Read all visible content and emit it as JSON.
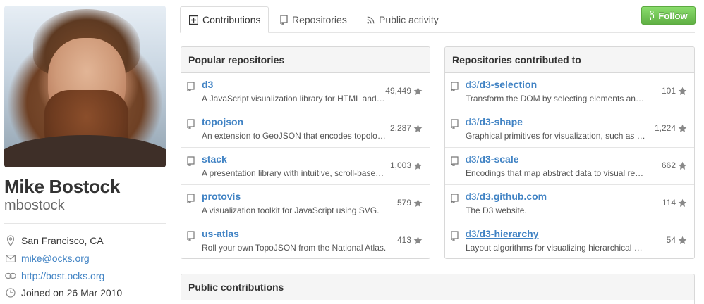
{
  "profile": {
    "fullname": "Mike Bostock",
    "username": "mbostock",
    "details": {
      "location": "San Francisco, CA",
      "email": "mike@ocks.org",
      "website": "http://bost.ocks.org",
      "joined": "Joined on 26 Mar 2010"
    }
  },
  "tabs": {
    "contributions": "Contributions",
    "repositories": "Repositories",
    "public_activity": "Public activity"
  },
  "follow_label": "Follow",
  "popular": {
    "title": "Popular repositories",
    "items": [
      {
        "name": "d3",
        "desc": "A JavaScript visualization library for HTML and SVG.",
        "stars": "49,449"
      },
      {
        "name": "topojson",
        "desc": "An extension to GeoJSON that encodes topology.",
        "stars": "2,287"
      },
      {
        "name": "stack",
        "desc": "A presentation library with intuitive, scroll-based navigation.",
        "stars": "1,003"
      },
      {
        "name": "protovis",
        "desc": "A visualization toolkit for JavaScript using SVG.",
        "stars": "579"
      },
      {
        "name": "us-atlas",
        "desc": "Roll your own TopoJSON from the National Atlas.",
        "stars": "413"
      }
    ]
  },
  "contributed": {
    "title": "Repositories contributed to",
    "items": [
      {
        "owner": "d3/",
        "name": "d3-selection",
        "desc": "Transform the DOM by selecting elements and joining to data.",
        "stars": "101"
      },
      {
        "owner": "d3/",
        "name": "d3-shape",
        "desc": "Graphical primitives for visualization, such as lines and areas.",
        "stars": "1,224"
      },
      {
        "owner": "d3/",
        "name": "d3-scale",
        "desc": "Encodings that map abstract data to visual representation.",
        "stars": "662"
      },
      {
        "owner": "d3/",
        "name": "d3.github.com",
        "desc": "The D3 website.",
        "stars": "114"
      },
      {
        "owner": "d3/",
        "name": "d3-hierarchy",
        "desc": "Layout algorithms for visualizing hierarchical data.",
        "stars": "54"
      }
    ]
  },
  "public_contributions": {
    "title": "Public contributions"
  }
}
